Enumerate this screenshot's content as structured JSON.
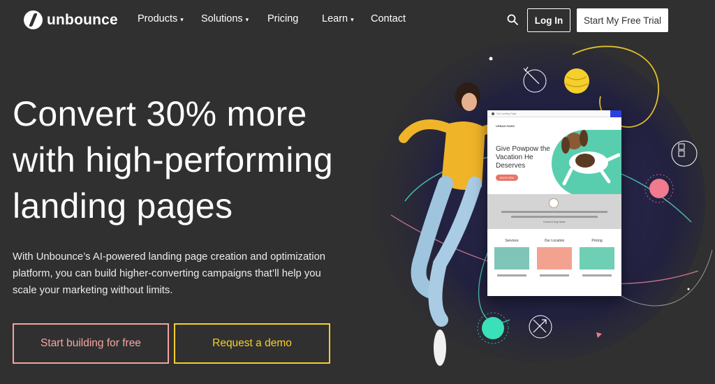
{
  "nav": {
    "logo_text": "unbounce",
    "items": [
      {
        "label": "Products",
        "has_dropdown": true
      },
      {
        "label": "Solutions",
        "has_dropdown": true
      },
      {
        "label": "Pricing",
        "has_dropdown": false
      },
      {
        "label": "Learn",
        "has_dropdown": true
      },
      {
        "label": "Contact",
        "has_dropdown": false
      }
    ],
    "search_icon": "search-icon",
    "login_label": "Log In",
    "trial_label": "Start My Free Trial"
  },
  "hero": {
    "headline_lines": [
      "Convert 30% more",
      "with high-performing",
      "landing pages"
    ],
    "subtext": "With Unbounce’s AI-powered landing page creation and optimization platform, you can build higher-converting campaigns that’ll help you scale your marketing without limits.",
    "primary_cta": "Start building for free",
    "secondary_cta": "Request a demo"
  },
  "mock_page": {
    "browser_label": "Our Landing Page",
    "brand": "URBAN PAWS",
    "title": "Give Powpow the Vacation He Deserves",
    "cta": "BOOK NOW",
    "testimonial_name": "Donna & Dog Name",
    "columns": [
      "Services",
      "Our Location",
      "Pricing"
    ]
  },
  "colors": {
    "background": "#303030",
    "primary_cta": "#f3a3a1",
    "secondary_cta": "#f5cf2d",
    "accent_green": "#47c9a5",
    "accent_yellow": "#f5cf2d"
  }
}
